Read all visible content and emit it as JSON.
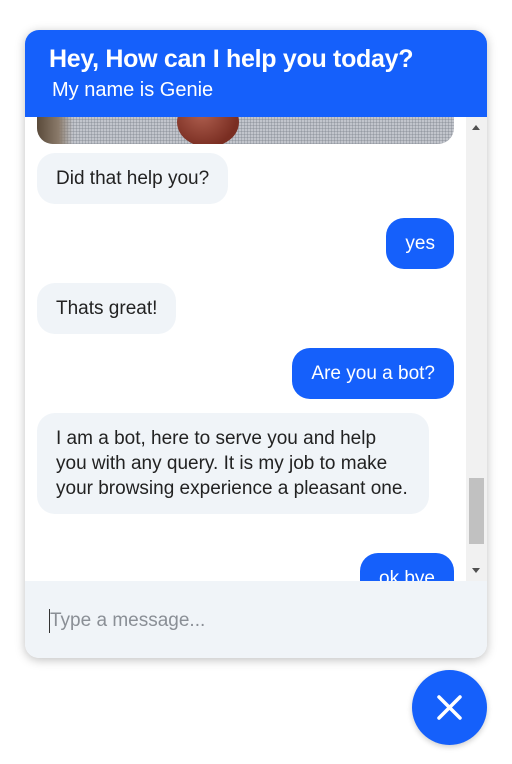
{
  "header": {
    "title": "Hey, How can I help you today?",
    "subtitle": "My name is Genie"
  },
  "messages": [
    {
      "sender": "bot",
      "type": "image"
    },
    {
      "sender": "bot",
      "text": "Did that help you?"
    },
    {
      "sender": "user",
      "text": "yes"
    },
    {
      "sender": "bot",
      "text": "Thats great!"
    },
    {
      "sender": "user",
      "text": "Are you a bot?"
    },
    {
      "sender": "bot",
      "text": "I am a bot, here to serve you and help you with any query. It is my job to make your browsing experience a pleasant one."
    },
    {
      "sender": "user",
      "text": "ok bye"
    }
  ],
  "composer": {
    "placeholder": "Type a message...",
    "value": ""
  },
  "icons": {
    "close": "close-icon",
    "scroll_up": "chevron-up-icon",
    "scroll_down": "chevron-down-icon"
  },
  "colors": {
    "accent": "#1560fb",
    "bot_bubble": "#f0f4f8",
    "bot_text": "#222222",
    "user_text": "#ffffff"
  }
}
